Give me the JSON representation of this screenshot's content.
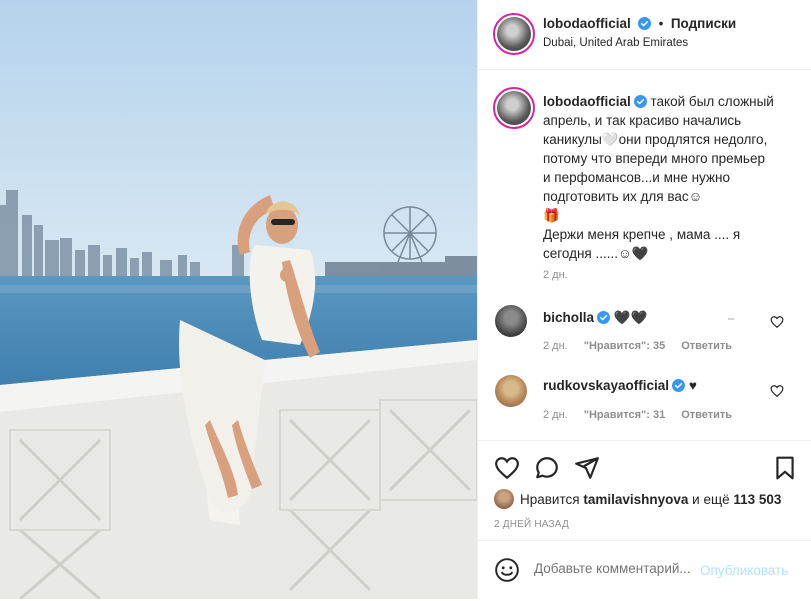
{
  "post": {
    "username": "lobodaofficial",
    "follow_sep": "•",
    "follow_label": "Подписки",
    "location": "Dubai, United Arab Emirates"
  },
  "caption": {
    "username": "lobodaofficial",
    "text_lines": [
      "такой был сложный",
      "апрель, и так красиво начались",
      "каникулы🤍они продлятся недолго,",
      "потому что впереди много премьер",
      "и перфомансов...и мне нужно",
      "подготовить их для вас☺",
      "🎁",
      "Держи меня крепче , мама .... я",
      "сегодня ......☺🖤"
    ],
    "time": "2 дн."
  },
  "comments": [
    {
      "username": "bicholla",
      "text": "🖤🖤",
      "time": "2 дн.",
      "likes": "\"Нравится\": 35",
      "reply": "Ответить"
    },
    {
      "username": "rudkovskayaofficial",
      "text": "♥",
      "time": "2 дн.",
      "likes": "\"Нравится\": 31",
      "reply": "Ответить"
    }
  ],
  "likes": {
    "prefix": "Нравится",
    "user": "tamilavishnyova",
    "middle": "и ещё",
    "count": "113 503"
  },
  "posted_ago": "2 ДНЕЙ НАЗАД",
  "add_comment": {
    "placeholder": "Добавьте комментарий...",
    "publish": "Опубликовать"
  },
  "colors": {
    "verified": "#3897f0",
    "link": "#b2dffc",
    "ring": "#d6249f"
  },
  "icons": [
    "heart-icon",
    "comment-icon",
    "share-icon",
    "bookmark-icon",
    "smiley-icon",
    "verified-icon"
  ]
}
